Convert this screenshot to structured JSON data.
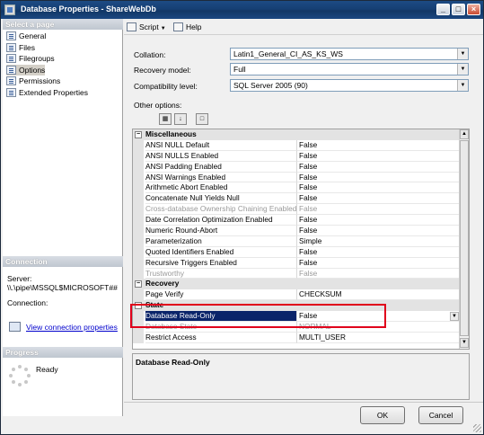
{
  "window": {
    "title": "Database Properties - ShareWebDb"
  },
  "left": {
    "select_header": "Select a page",
    "pages": [
      {
        "label": "General",
        "icon": "page-icon"
      },
      {
        "label": "Files",
        "icon": "page-icon"
      },
      {
        "label": "Filegroups",
        "icon": "page-icon"
      },
      {
        "label": "Options",
        "icon": "page-icon",
        "selected": true
      },
      {
        "label": "Permissions",
        "icon": "page-icon"
      },
      {
        "label": "Extended Properties",
        "icon": "page-icon"
      }
    ],
    "connection_header": "Connection",
    "server_label": "Server:",
    "server_value": "\\\\.\\pipe\\MSSQL$MICROSOFT##",
    "connection_label": "Connection:",
    "view_link": "View connection properties",
    "progress_header": "Progress",
    "progress_status": "Ready"
  },
  "toolbar": {
    "script_label": "Script",
    "help_label": "Help"
  },
  "form": {
    "collation_label": "Collation:",
    "collation_value": "Latin1_General_CI_AS_KS_WS",
    "recovery_label": "Recovery model:",
    "recovery_value": "Full",
    "compat_label": "Compatibility level:",
    "compat_value": "SQL Server 2005 (90)",
    "other_label": "Other options:"
  },
  "grid": {
    "rows": [
      {
        "type": "cat",
        "name": "Miscellaneous"
      },
      {
        "name": "ANSI NULL Default",
        "value": "False"
      },
      {
        "name": "ANSI NULLS Enabled",
        "value": "False"
      },
      {
        "name": "ANSI Padding Enabled",
        "value": "False"
      },
      {
        "name": "ANSI Warnings Enabled",
        "value": "False"
      },
      {
        "name": "Arithmetic Abort Enabled",
        "value": "False"
      },
      {
        "name": "Concatenate Null Yields Null",
        "value": "False"
      },
      {
        "name": "Cross-database Ownership Chaining Enabled",
        "value": "False",
        "disabled": true
      },
      {
        "name": "Date Correlation Optimization Enabled",
        "value": "False"
      },
      {
        "name": "Numeric Round-Abort",
        "value": "False"
      },
      {
        "name": "Parameterization",
        "value": "Simple"
      },
      {
        "name": "Quoted Identifiers Enabled",
        "value": "False"
      },
      {
        "name": "Recursive Triggers Enabled",
        "value": "False"
      },
      {
        "name": "Trustworthy",
        "value": "False",
        "disabled": true
      },
      {
        "type": "cat",
        "name": "Recovery"
      },
      {
        "name": "Page Verify",
        "value": "CHECKSUM"
      },
      {
        "type": "cat",
        "name": "State"
      },
      {
        "name": "Database Read-Only",
        "value": "False",
        "selected": true
      },
      {
        "name": "Database State",
        "value": "NORMAL",
        "disabled": true
      },
      {
        "name": "Restrict Access",
        "value": "MULTI_USER"
      }
    ]
  },
  "description": {
    "title": "Database Read-Only"
  },
  "buttons": {
    "ok": "OK",
    "cancel": "Cancel"
  },
  "colors": {
    "titlebar": "#163f74",
    "selection": "#0a246a",
    "highlight_box": "#e0001b",
    "link": "#0000cc"
  }
}
